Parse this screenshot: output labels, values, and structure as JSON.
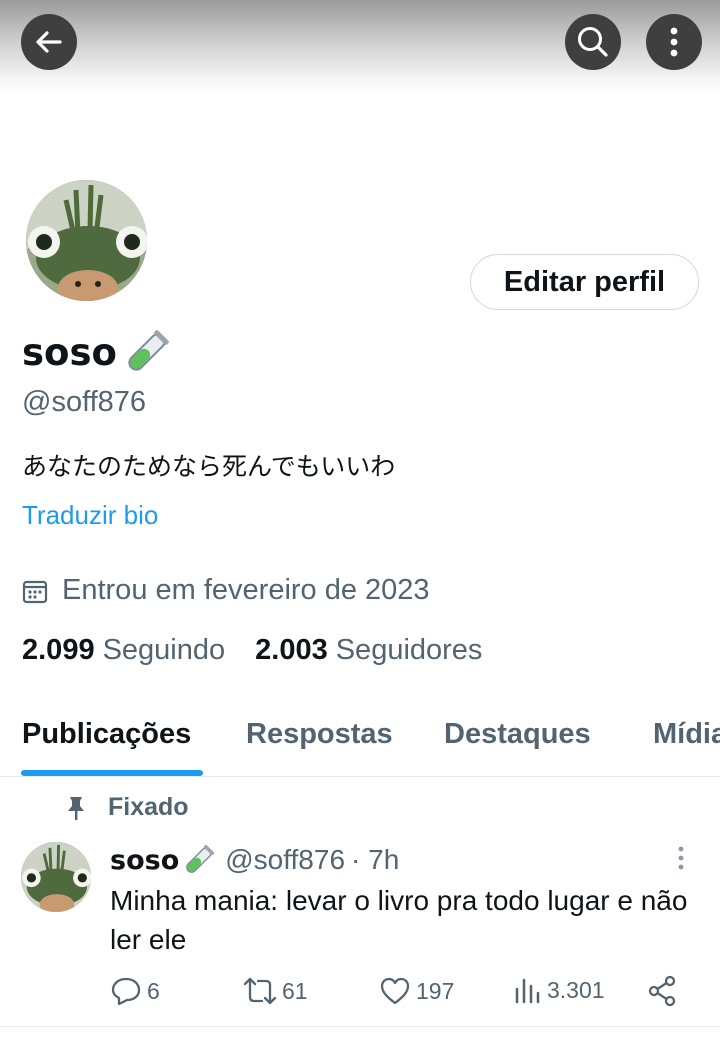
{
  "header": {
    "back_icon": "arrow-left-icon",
    "search_icon": "search-icon",
    "more_icon": "more-vertical-icon"
  },
  "profile": {
    "display_name": "soso",
    "name_emoji_icon": "test-tube-icon",
    "handle": "@soff876",
    "bio": "あなたのためなら死んでもいいわ",
    "translate_label": "Traduzir bio",
    "joined_icon": "calendar-icon",
    "joined": "Entrou em fevereiro de 2023",
    "following_count": "2.099",
    "following_label": "Seguindo",
    "followers_count": "2.003",
    "followers_label": "Seguidores",
    "edit_label": "Editar perfil"
  },
  "tabs": [
    {
      "label": "Publicações",
      "active": true
    },
    {
      "label": "Respostas",
      "active": false
    },
    {
      "label": "Destaques",
      "active": false
    },
    {
      "label": "Mídia",
      "active": false
    }
  ],
  "pinned_post": {
    "pinned_label": "Fixado",
    "author_name": "soso",
    "author_handle": "@soff876",
    "time": "· 7h",
    "text": "Minha mania: levar o livro pra todo lugar e não ler ele",
    "replies": "6",
    "reposts": "61",
    "likes": "197",
    "views": "3.301"
  },
  "colors": {
    "accent": "#1d9bf0",
    "text_primary": "#0f1419",
    "text_secondary": "#536471",
    "border": "#cfd9de"
  }
}
